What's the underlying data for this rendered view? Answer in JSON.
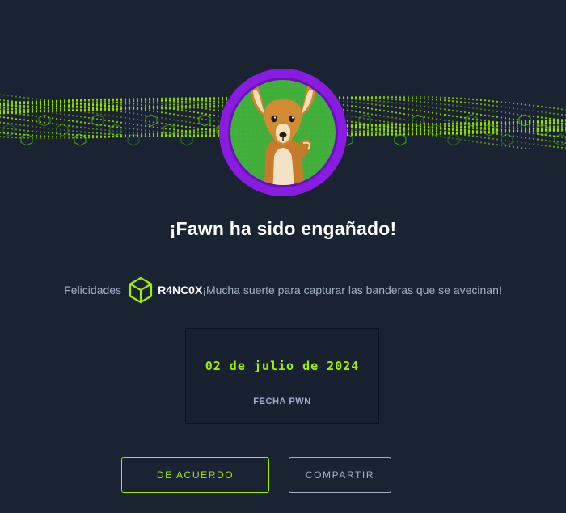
{
  "dialog": {
    "title": "¡Fawn ha sido engañado!",
    "congrats_prefix": "Felicidades",
    "username": "R4NC0X",
    "congrats_suffix": "¡Mucha suerte para capturar las banderas que se avecinan!",
    "date_value": "02 de julio de 2024",
    "date_label": "FECHA PWN",
    "ok_button": "DE ACUERDO",
    "share_button": "COMPARTIR"
  },
  "icons": {
    "user_badge": "cube-icon",
    "avatar": "fawn-avatar"
  },
  "colors": {
    "background": "#1a2332",
    "accent": "#9fef00",
    "muted_text": "#a4b1cd",
    "avatar_ring": "#8a1be3"
  }
}
